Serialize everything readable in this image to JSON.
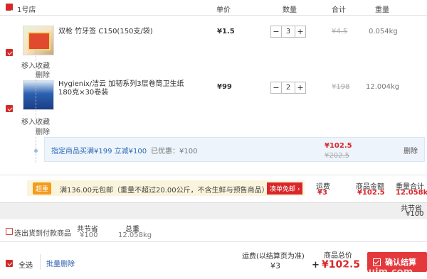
{
  "header": {
    "store_name": "1号店",
    "col_price": "单价",
    "col_qty": "数量",
    "col_total": "合计",
    "col_weight": "重量"
  },
  "items": [
    {
      "name": "双枪 竹牙签 C150(150支/袋)",
      "price": "¥1.5",
      "qty": "3",
      "subtotal": "¥4.5",
      "weight": "0.054kg",
      "move_fav": "移入收藏",
      "delete": "删除"
    },
    {
      "name": "Hygienix/洁云 加韧系列3层卷筒卫生纸 180克×30卷装",
      "price": "¥99",
      "qty": "2",
      "subtotal": "¥198",
      "weight": "12.004kg",
      "move_fav": "移入收藏",
      "delete": "删除"
    }
  ],
  "promo": {
    "text": "指定商品买满¥199 立减¥100",
    "saved": "已优惠：¥100",
    "price_new": "¥102.5",
    "price_old": "¥202.5",
    "delete": "删除"
  },
  "shipping": {
    "tag": "超重",
    "text": "满136.00元包邮（重量不超过20.00公斤，不含生鲜与预售商品）",
    "cou_button": "凑单免邮 ›",
    "freight_label": "运费",
    "freight_value": "¥3",
    "goods_label": "商品金额",
    "goods_value": "¥102.5",
    "weight_label": "重量合计",
    "weight_value": "12.058kg"
  },
  "savings": {
    "label": "共节省",
    "value": "¥100"
  },
  "subtotal_row": {
    "cod_label": "选出货到付款商品",
    "saved_label": "共节省",
    "saved_value": "¥100",
    "weight_label": "总重",
    "weight_value": "12.058kg"
  },
  "footer": {
    "select_all": "全选",
    "batch_delete": "批量删除",
    "freight_label": "运费(以结算页为准)",
    "freight_value": "¥3",
    "plus": "+",
    "total_label": "商品总价",
    "total_value": "¥102.5",
    "confirm": "确认结算",
    "watermark": "惠咖 huim.com"
  },
  "colors": {
    "accent": "#d9262a",
    "promo_bg": "#eef4fb",
    "ship_bg": "#fbf4dc"
  }
}
